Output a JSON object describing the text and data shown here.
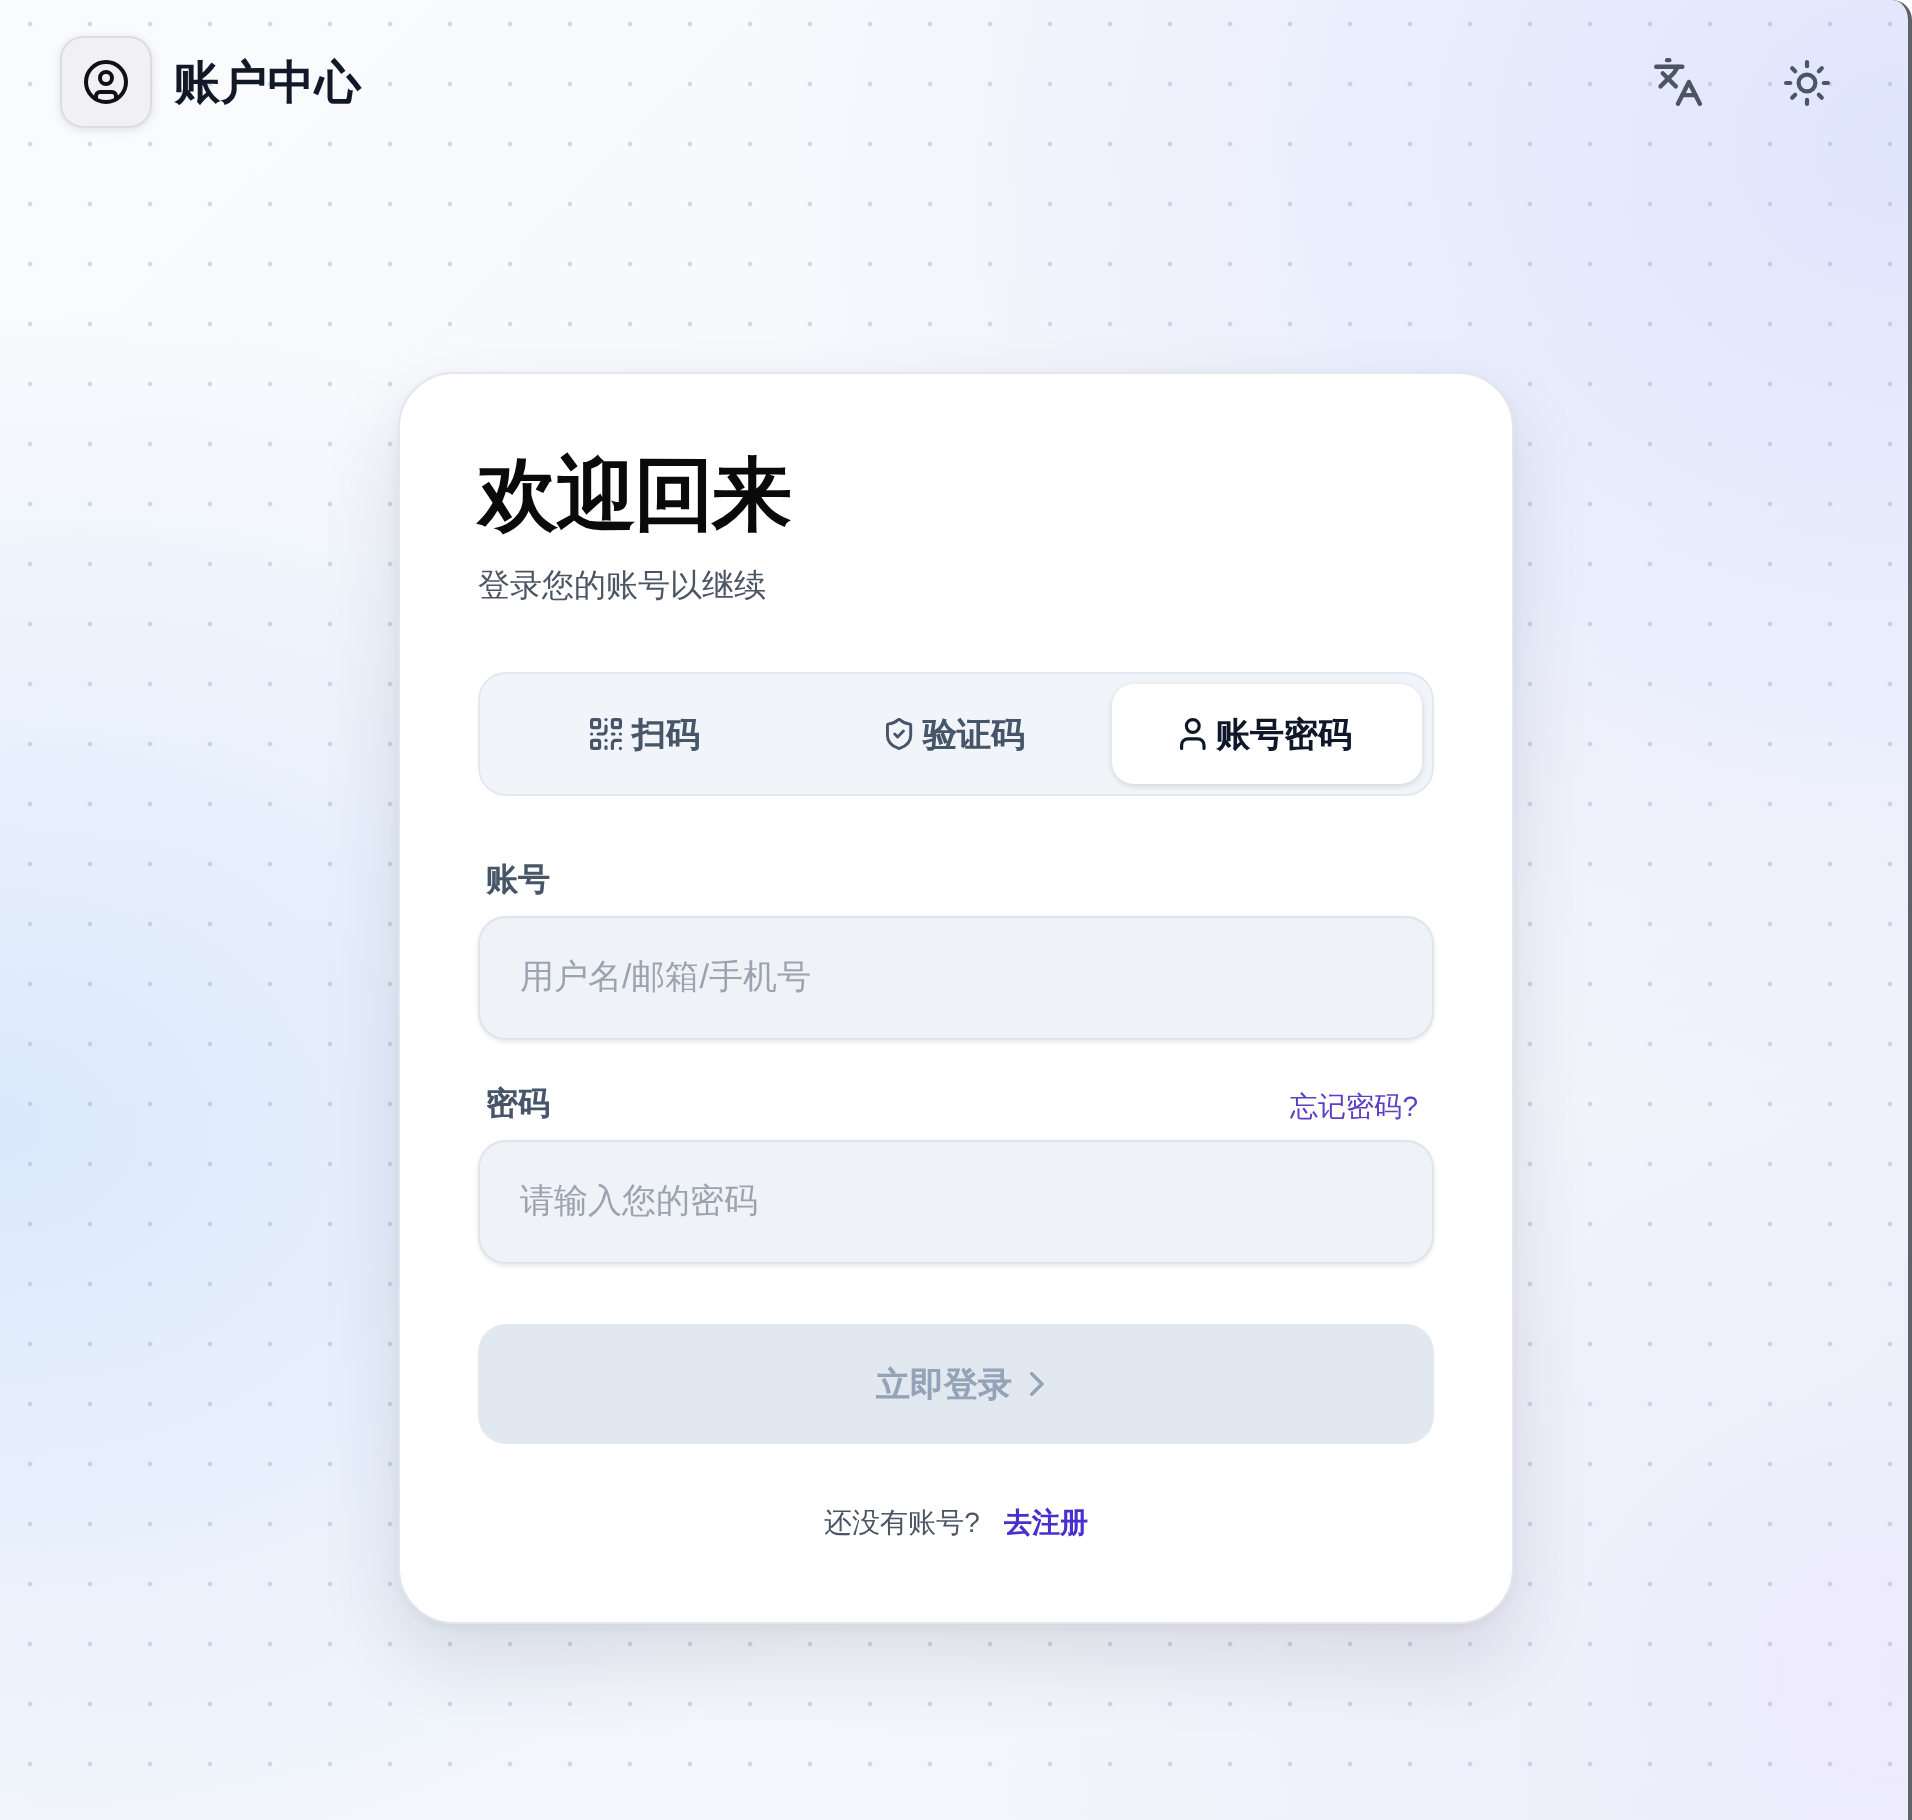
{
  "header": {
    "title": "账户中心"
  },
  "card": {
    "title": "欢迎回来",
    "subtitle": "登录您的账号以继续",
    "tabs": [
      {
        "kind": "scan",
        "label": "扫码",
        "selected": false
      },
      {
        "kind": "code",
        "label": "验证码",
        "selected": false
      },
      {
        "kind": "password",
        "label": "账号密码",
        "selected": true
      }
    ],
    "fields": [
      {
        "label": "账号",
        "placeholder": "用户名/邮箱/手机号"
      },
      {
        "label": "密码",
        "placeholder": "请输入您的密码",
        "link": "忘记密码?"
      }
    ],
    "submit": {
      "label": "立即登录",
      "disabled": true
    },
    "footer": {
      "prompt": "还没有账号?",
      "link": "去注册"
    }
  }
}
